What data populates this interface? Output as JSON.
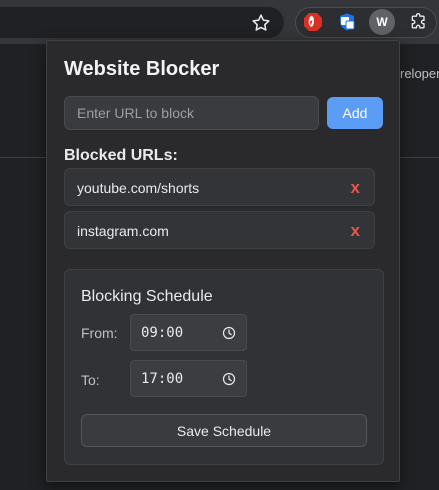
{
  "browser": {
    "extension_avatar_letter": "W",
    "page_background_text": "reloper"
  },
  "popup": {
    "title": "Website Blocker",
    "url_input": {
      "placeholder": "Enter URL to block",
      "value": ""
    },
    "add_label": "Add",
    "blocked_heading": "Blocked URLs:",
    "blocked_urls": [
      {
        "url": "youtube.com/shorts",
        "remove_label": "x"
      },
      {
        "url": "instagram.com",
        "remove_label": "x"
      }
    ],
    "schedule": {
      "title": "Blocking Schedule",
      "from_label": "From:",
      "from_value": "09:00",
      "to_label": "To:",
      "to_value": "17:00",
      "save_label": "Save Schedule"
    }
  },
  "colors": {
    "accent": "#5b9cf5",
    "remove": "#e8574a",
    "popup_bg": "#2a2a2c",
    "page_bg": "#202124"
  }
}
